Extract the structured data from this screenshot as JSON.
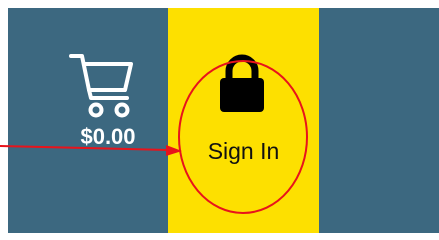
{
  "cart": {
    "icon": "shopping-cart-icon",
    "total": "$0.00"
  },
  "signin": {
    "icon": "lock-icon",
    "label": "Sign In"
  },
  "annotation": {
    "arrow_color": "#e8131b",
    "circle_color": "#e8131b"
  },
  "colors": {
    "nav_background": "#3c6880",
    "signin_background": "#fde000",
    "cart_foreground": "#ffffff",
    "signin_foreground": "#111111"
  }
}
